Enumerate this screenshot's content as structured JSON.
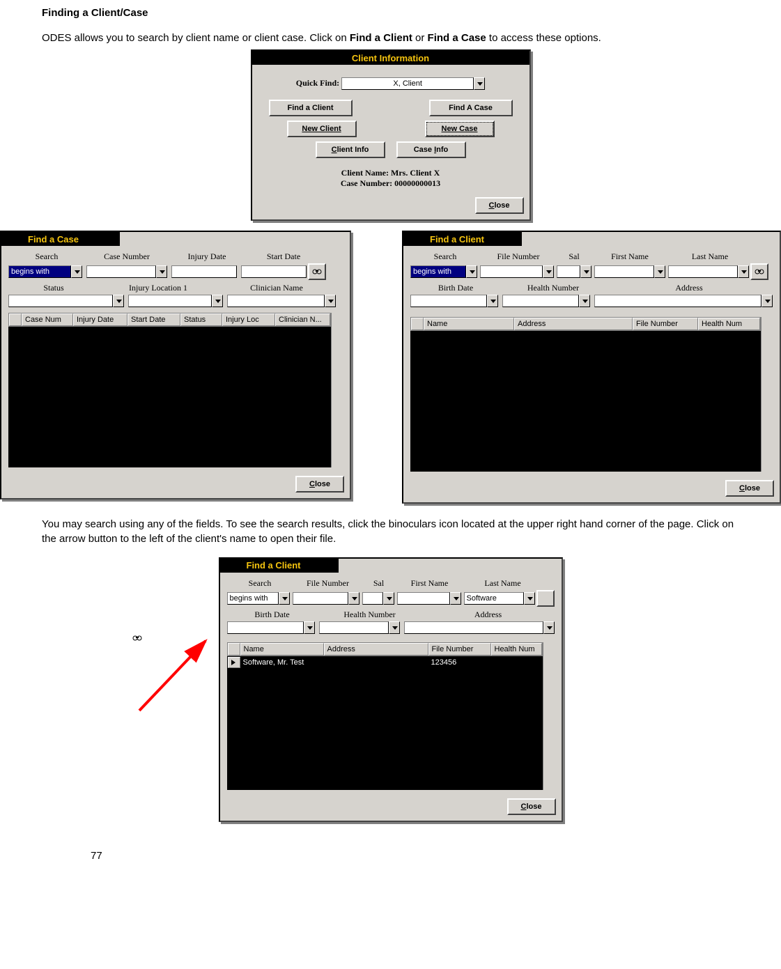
{
  "doc": {
    "heading": "Finding a Client/Case",
    "intro_part1": "ODES allows you to search by client name or client case. Click on ",
    "intro_bold1": "Find a Client",
    "intro_mid": " or ",
    "intro_bold2": "Find a Case",
    "intro_part2": " to access these options.",
    "para2": "You may search using any of the fields.  To see the search results, click the binoculars icon located at the upper right hand corner of the page. Click on the arrow button to the left of the client's name to open their file.",
    "page_number": "77"
  },
  "client_info_dlg": {
    "title": "Client Information",
    "quick_find_label": "Quick Find:",
    "quick_find_value": "X, Client",
    "buttons": {
      "find_client": "Find a Client",
      "find_case": "Find A Case",
      "new_client": "New Client",
      "new_case": "New Case",
      "client_info_pre": "C",
      "client_info_post": "lient Info",
      "case_info_pre": "Case ",
      "case_info_mid": "I",
      "case_info_post": "nfo"
    },
    "client_name_label": "Client Name: ",
    "client_name_value": "Mrs. Client X",
    "case_number_label": "Case Number: ",
    "case_number_value": "00000000013",
    "close_pre": "C",
    "close_post": "lose"
  },
  "find_case_dlg": {
    "title": "Find a Case",
    "labels": {
      "search": "Search",
      "case_number": "Case Number",
      "injury_date": "Injury Date",
      "start_date": "Start Date",
      "status": "Status",
      "injury_loc": "Injury Location 1",
      "clinician": "Clinician Name"
    },
    "search_mode": "begins with",
    "columns": [
      "Case Num",
      "Injury Date",
      "Start Date",
      "Status",
      "Injury Loc",
      "Clinician N..."
    ],
    "close_pre": "C",
    "close_post": "lose"
  },
  "find_client_dlg": {
    "title": "Find a Client",
    "labels": {
      "search": "Search",
      "file_number": "File Number",
      "sal": "Sal",
      "first_name": "First Name",
      "last_name": "Last Name",
      "birth_date": "Birth Date",
      "health_number": "Health Number",
      "address": "Address"
    },
    "search_mode": "begins with",
    "columns": [
      "Name",
      "Address",
      "File Number",
      "Health Num"
    ],
    "close_pre": "C",
    "close_post": "lose"
  },
  "find_client_dlg2": {
    "title": "Find a Client",
    "labels": {
      "search": "Search",
      "file_number": "File Number",
      "sal": "Sal",
      "first_name": "First Name",
      "last_name": "Last Name",
      "birth_date": "Birth Date",
      "health_number": "Health Number",
      "address": "Address"
    },
    "search_mode": "begins with",
    "last_name_value": "Software",
    "columns": [
      "Name",
      "Address",
      "File Number",
      "Health Num"
    ],
    "row": {
      "name": "Software, Mr. Test",
      "address": "",
      "file_number": "123456",
      "health_num": ""
    },
    "close_pre": "C",
    "close_post": "lose"
  }
}
